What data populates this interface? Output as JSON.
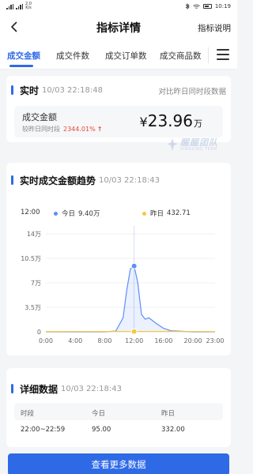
{
  "status_bar": {
    "network_speed_value": "2.0",
    "network_speed_unit": "K/s",
    "battery": "10:19"
  },
  "nav": {
    "title": "指标详情",
    "help_label": "指标说明"
  },
  "tabs": [
    {
      "label": "成交金额",
      "active": true
    },
    {
      "label": "成交件数",
      "active": false
    },
    {
      "label": "成交订单数",
      "active": false
    },
    {
      "label": "成交商品数",
      "active": false
    }
  ],
  "realtime": {
    "title": "实时",
    "time": "10/03 22:18:48",
    "compare_label": "对比昨日同时段数据",
    "metric_label": "成交金额",
    "compare_prefix": "较昨日同时段",
    "compare_pct": "2344.01%",
    "currency": "¥",
    "value": "23.96",
    "unit": "万",
    "watermark_title": "醒醒团队",
    "watermark_sub": "XINGXING TEAM"
  },
  "trend": {
    "title": "实时成交金额趋势",
    "time": "10/03 22:18:43",
    "tooltip_time": "12:00",
    "today_label": "今日",
    "today_value": "9.40万",
    "yesterday_label": "昨日",
    "yesterday_value": "432.71"
  },
  "chart_data": {
    "type": "line",
    "x_tick_labels": [
      "0:00",
      "4:00",
      "8:00",
      "12:00",
      "16:00",
      "20:00",
      "23:00"
    ],
    "y_tick_labels": [
      "0",
      "3.5万",
      "7万",
      "10.5万",
      "14万"
    ],
    "ylim": [
      0,
      140000
    ],
    "xlim": [
      0,
      23
    ],
    "grid": true,
    "highlight_x": 12,
    "series": [
      {
        "name": "今日",
        "color": "#5b8ff9",
        "x": [
          0,
          4,
          8,
          9.5,
          10.5,
          11,
          11.5,
          12,
          12.5,
          13,
          13.5,
          14,
          15,
          16,
          17,
          20,
          23
        ],
        "y": [
          0,
          0,
          0,
          1000,
          20000,
          60000,
          90000,
          94000,
          70000,
          25000,
          18000,
          20000,
          12000,
          5000,
          1500,
          0,
          0
        ]
      },
      {
        "name": "昨日",
        "color": "#f5c842",
        "x": [
          0,
          4,
          8,
          12,
          16,
          20,
          23
        ],
        "y": [
          300,
          350,
          400,
          432.71,
          400,
          350,
          300
        ]
      }
    ]
  },
  "detail": {
    "title": "详细数据",
    "time": "10/03 22:18:43",
    "headers": [
      "时段",
      "今日",
      "昨日"
    ],
    "rows": [
      [
        "22:00~22:59",
        "95.00",
        "332.00"
      ]
    ]
  },
  "footer": {
    "more_label": "查看更多数据"
  },
  "colors": {
    "accent": "#2f6ae6",
    "up": "#e9473a"
  }
}
